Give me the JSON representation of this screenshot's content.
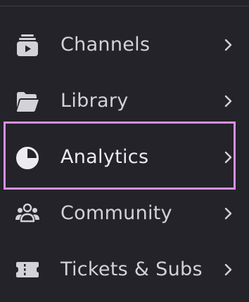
{
  "menu": {
    "items": [
      {
        "label": "Channels",
        "icon": "channels-icon"
      },
      {
        "label": "Library",
        "icon": "folder-icon"
      },
      {
        "label": "Analytics",
        "icon": "pie-chart-icon"
      },
      {
        "label": "Community",
        "icon": "community-icon"
      },
      {
        "label": "Tickets & Subs",
        "icon": "ticket-icon"
      }
    ]
  },
  "colors": {
    "background": "#232329",
    "text": "#d2d2d8",
    "highlight": "#d68ff7"
  }
}
